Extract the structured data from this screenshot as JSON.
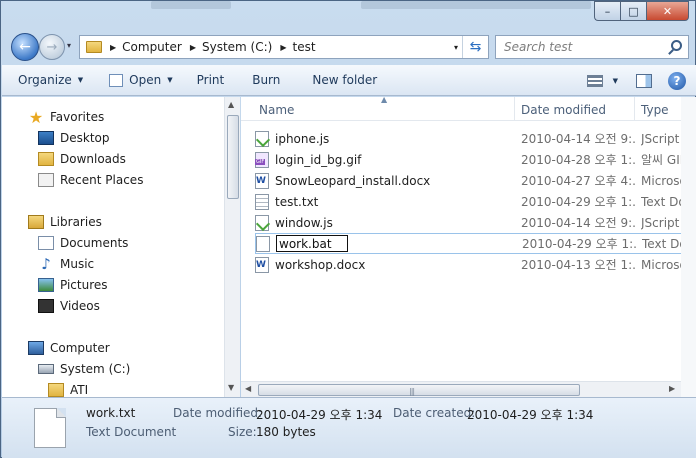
{
  "window": {
    "controls": {
      "minimize": "–",
      "maximize": "□",
      "close": "✕"
    }
  },
  "nav": {
    "back_glyph": "←",
    "forward_glyph": "→",
    "dropdown_glyph": "▾",
    "breadcrumb": [
      "Computer",
      "System (C:)",
      "test"
    ],
    "refresh_glyph": "⇆",
    "search_placeholder": "Search test"
  },
  "toolbar": {
    "organize": "Organize",
    "open": "Open",
    "print": "Print",
    "burn": "Burn",
    "new_folder": "New folder",
    "help": "?"
  },
  "sidebar": {
    "favorites_label": "Favorites",
    "favorites": [
      "Desktop",
      "Downloads",
      "Recent Places"
    ],
    "libraries_label": "Libraries",
    "libraries": [
      "Documents",
      "Music",
      "Pictures",
      "Videos"
    ],
    "computer_label": "Computer",
    "computer": [
      "System (C:)",
      "ATI"
    ]
  },
  "columns": {
    "name": "Name",
    "date_modified": "Date modified",
    "type": "Type"
  },
  "files": [
    {
      "name": "iphone.js",
      "date": "2010-04-14 오전 9:...",
      "type": "JScript Sc",
      "icon": "js-file-icon"
    },
    {
      "name": "login_id_bg.gif",
      "date": "2010-04-28 오후 1:...",
      "type": "알씨 GIF",
      "icon": "gif-file-icon"
    },
    {
      "name": "SnowLeopard_install.docx",
      "date": "2010-04-27 오후 4:...",
      "type": "Microsof",
      "icon": "word-file-icon"
    },
    {
      "name": "test.txt",
      "date": "2010-04-29 오후 1:...",
      "type": "Text Doc",
      "icon": "text-file-icon"
    },
    {
      "name": "window.js",
      "date": "2010-04-14 오전 9:...",
      "type": "JScript Sc",
      "icon": "js-file-icon"
    },
    {
      "name": "work.bat",
      "date": "2010-04-29 오후 1:...",
      "type": "Text Doc",
      "icon": "batch-file-icon",
      "editing": true
    },
    {
      "name": "workshop.docx",
      "date": "2010-04-13 오전 1:...",
      "type": "Microsof",
      "icon": "word-file-icon"
    }
  ],
  "details": {
    "filename": "work.txt",
    "filetype": "Text Document",
    "date_modified_label": "Date modified:",
    "date_modified": "2010-04-29 오후 1:34",
    "date_created_label": "Date created:",
    "date_created": "2010-04-29 오후 1:34",
    "size_label": "Size:",
    "size": "180 bytes"
  }
}
